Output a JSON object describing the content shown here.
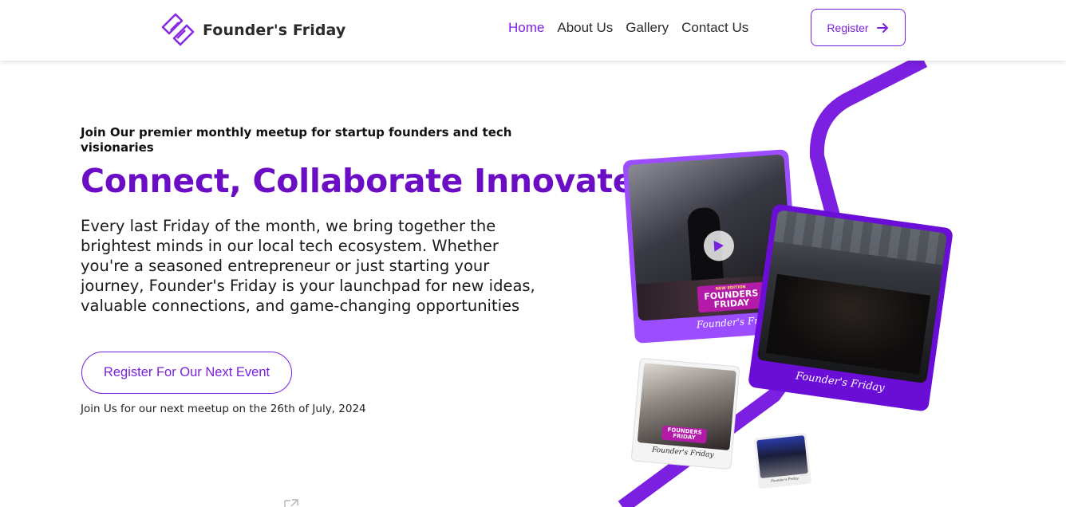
{
  "brand": {
    "name": "Founder's Friday",
    "accent": "#7b1fe0",
    "headline_color": "#6a0dc4"
  },
  "nav": {
    "items": [
      {
        "label": "Home",
        "active": true
      },
      {
        "label": "About Us",
        "active": false
      },
      {
        "label": "Gallery",
        "active": false
      },
      {
        "label": "Contact Us",
        "active": false
      }
    ],
    "register_label": "Register",
    "register_icon": "arrow-right-icon"
  },
  "hero": {
    "kicker": "Join Our premier monthly meetup for startup founders and tech visionaries",
    "headline": "Connect, Collaborate Innovate!",
    "body": "Every last Friday of the month, we bring together the brightest minds in our local tech ecosystem. Whether you're a seasoned entrepreneur or just starting your journey, Founder's Friday is your launchpad for new ideas, valuable connections, and game-changing opportunities",
    "cta_label": "Register For Our Next Event",
    "next_event_note": "Join Us for our next meetup on the 26th of July, 2024"
  },
  "gallery": {
    "video_card": {
      "caption": "Founder's Friday",
      "badge_top": "NEW EDITION",
      "badge_main": "FOUNDERS FRIDAY",
      "play_icon": "play-icon"
    },
    "group_card": {
      "caption": "Founder's Friday"
    },
    "small_card": {
      "caption": "Founder's Friday",
      "badge_main": "FOUNDERS FRIDAY"
    },
    "tiny_card": {
      "caption": "Founder's Friday"
    }
  }
}
